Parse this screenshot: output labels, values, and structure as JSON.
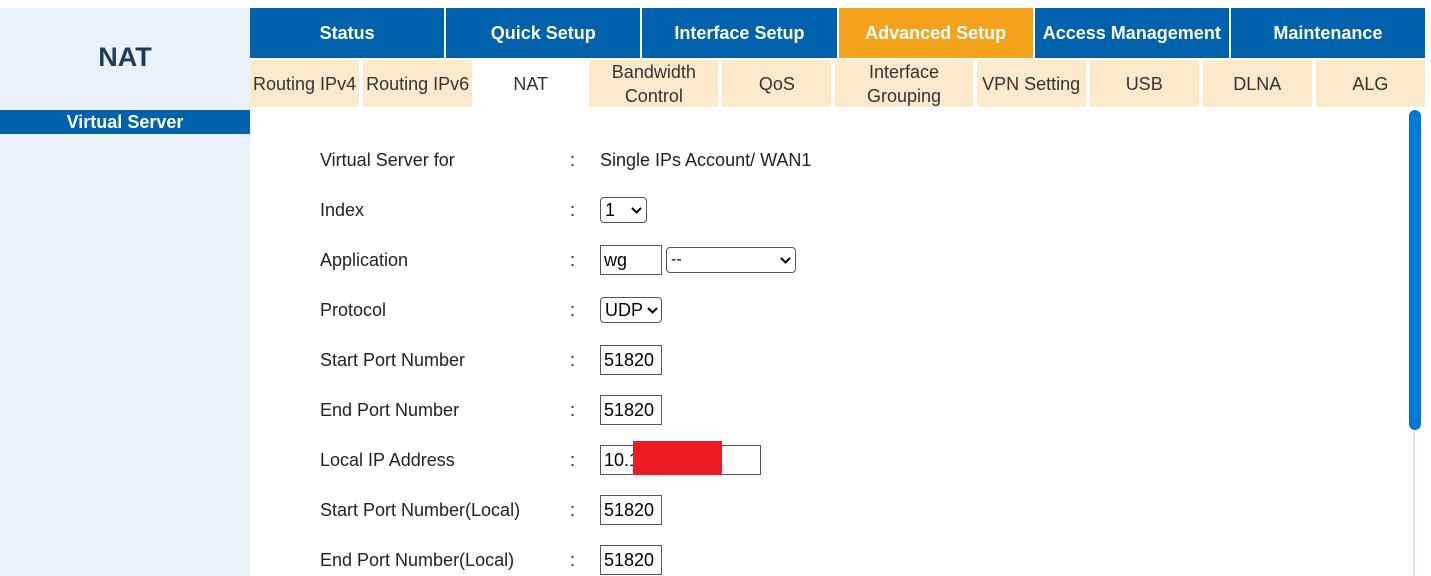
{
  "sidebar": {
    "title": "NAT",
    "items": [
      {
        "label": "Virtual Server"
      }
    ]
  },
  "main_tabs": [
    {
      "label": "Status"
    },
    {
      "label": "Quick Setup"
    },
    {
      "label": "Interface Setup"
    },
    {
      "label": "Advanced Setup"
    },
    {
      "label": "Access Management"
    },
    {
      "label": "Maintenance"
    }
  ],
  "active_main_tab": "Advanced Setup",
  "sub_tabs": [
    {
      "label": "Routing IPv4"
    },
    {
      "label": "Routing IPv6"
    },
    {
      "label": "NAT"
    },
    {
      "label": "Bandwidth Control"
    },
    {
      "label": "QoS"
    },
    {
      "label": "Interface Grouping"
    },
    {
      "label": "VPN Setting"
    },
    {
      "label": "USB"
    },
    {
      "label": "DLNA"
    },
    {
      "label": "ALG"
    }
  ],
  "active_sub_tab": "NAT",
  "form": {
    "colon": ":",
    "virtual_server_for": {
      "label": "Virtual Server for",
      "value": "Single IPs Account/ WAN1"
    },
    "index": {
      "label": "Index",
      "value": "1"
    },
    "application": {
      "label": "Application",
      "value": "wg",
      "select_value": "--"
    },
    "protocol": {
      "label": "Protocol",
      "value": "UDP"
    },
    "start_port": {
      "label": "Start Port Number",
      "value": "51820"
    },
    "end_port": {
      "label": "End Port Number",
      "value": "51820"
    },
    "local_ip": {
      "label": "Local IP Address",
      "value": "10.1"
    },
    "start_port_local": {
      "label": "Start Port Number(Local)",
      "value": "51820"
    },
    "end_port_local": {
      "label": "End Port Number(Local)",
      "value": "51820"
    }
  },
  "colors": {
    "nav_blue": "#0061ad",
    "active_orange": "#f4a21c",
    "subtab_beige": "#fde9cc",
    "sidebar_bg": "#e9f1f9",
    "redaction_red": "#ed1c24",
    "scrollbar_blue": "#0078d7"
  },
  "icons": {
    "dropdown": "chevron-down-icon"
  }
}
